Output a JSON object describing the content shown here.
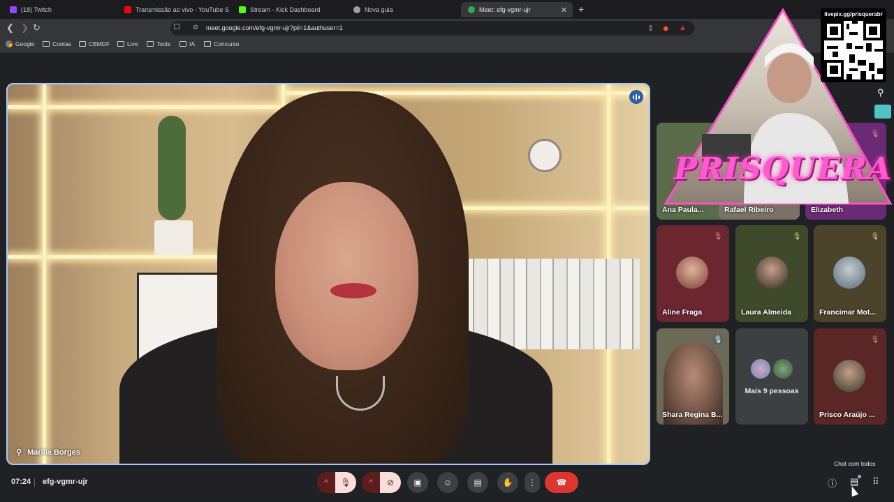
{
  "browser": {
    "tabs": [
      {
        "label": "(18) Twitch",
        "favicon_color": "#9146ff"
      },
      {
        "label": "Transmissão ao vivo - YouTube Studio",
        "favicon_color": "#ff0000"
      },
      {
        "label": "Stream - Kick Dashboard",
        "favicon_color": "#53fc18"
      },
      {
        "label": "Nova guia",
        "favicon_color": "#9aa0a6"
      },
      {
        "label": "Meet: efg-vgmr-ujr",
        "favicon_color": "#34a853"
      }
    ],
    "new_tab_glyph": "+",
    "url": "meet.google.com/efg-vgmr-ujr?pli=1&authuser=1",
    "bookmarks": [
      "Google",
      "Contas",
      "CBMDF",
      "Live",
      "Tools",
      "IA",
      "Concurso"
    ]
  },
  "meet": {
    "main_speaker": "Marília Borges",
    "participants": [
      {
        "name": "Ana Paula...",
        "muted": false,
        "bg": "#5a6b4a"
      },
      {
        "name": "Rafael Ribeiro",
        "muted": false,
        "bg": "#7a7167"
      },
      {
        "name": "Elizabeth",
        "muted": true,
        "bg": "#6b2a76"
      },
      {
        "name": "Aline Fraga",
        "muted": true,
        "bg": "#6b2630"
      },
      {
        "name": "Laura Almeida",
        "muted": true,
        "bg": "#3f4a2a"
      },
      {
        "name": "Francimar Mot...",
        "muted": true,
        "bg": "#4b432a"
      },
      {
        "name": "Shara Regina B...",
        "muted": true,
        "bg": "#6b6a56"
      },
      {
        "name": "Prisco Araújo ...",
        "muted": true,
        "bg": "#5a2626"
      }
    ],
    "more_people": "Mais 9 pessoas",
    "time": "07:24",
    "meeting_code": "efg-vgmr-ujr",
    "tooltip": "Chat com todos"
  },
  "overlay": {
    "brand": "PRISQUERA",
    "qr_label": "livepix.gg/prisquerabr",
    "accent": "#ff5ad2"
  },
  "colors": {
    "end_call": "#dc362e",
    "active_border": "#a8c7fa"
  }
}
